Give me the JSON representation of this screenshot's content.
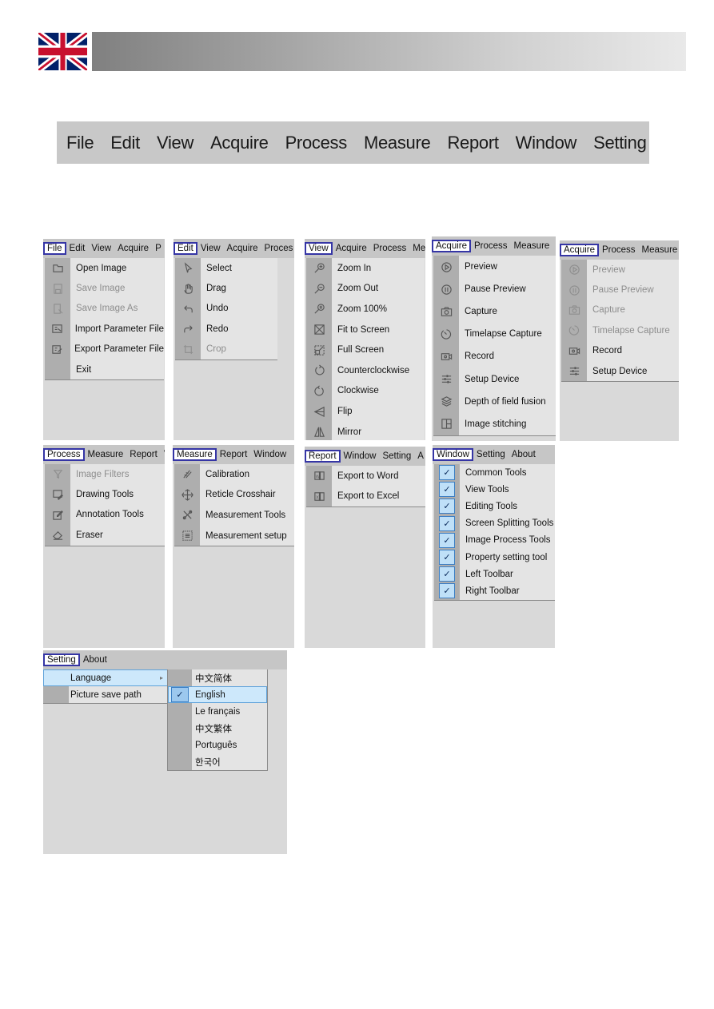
{
  "header": {
    "flag_icon": "uk-flag-icon"
  },
  "main_menu": [
    "File",
    "Edit",
    "View",
    "Acquire",
    "Process",
    "Measure",
    "Report",
    "Window",
    "Setting"
  ],
  "panels": {
    "file": {
      "bar": [
        "File",
        "Edit",
        "View",
        "Acquire",
        "P"
      ],
      "items": [
        {
          "label": "Open Image",
          "icon": "folder-icon",
          "enabled": true
        },
        {
          "label": "Save Image",
          "icon": "save-icon",
          "enabled": false
        },
        {
          "label": "Save Image As",
          "icon": "save-as-icon",
          "enabled": false
        },
        {
          "label": "Import Parameter File",
          "icon": "import-icon",
          "enabled": true
        },
        {
          "label": "Export Parameter File",
          "icon": "export-icon",
          "enabled": true
        },
        {
          "label": "Exit",
          "icon": "",
          "enabled": true
        }
      ]
    },
    "edit": {
      "bar": [
        "Edit",
        "View",
        "Acquire",
        "Proces"
      ],
      "items": [
        {
          "label": "Select",
          "icon": "cursor-icon",
          "enabled": true
        },
        {
          "label": "Drag",
          "icon": "hand-icon",
          "enabled": true
        },
        {
          "label": "Undo",
          "icon": "undo-icon",
          "enabled": true
        },
        {
          "label": "Redo",
          "icon": "redo-icon",
          "enabled": true
        },
        {
          "label": "Crop",
          "icon": "crop-icon",
          "enabled": false
        }
      ]
    },
    "view": {
      "bar": [
        "View",
        "Acquire",
        "Process",
        "Me"
      ],
      "items": [
        {
          "label": "Zoom In",
          "icon": "zoom-in-icon",
          "enabled": true
        },
        {
          "label": "Zoom Out",
          "icon": "zoom-out-icon",
          "enabled": true
        },
        {
          "label": "Zoom 100%",
          "icon": "zoom-100-icon",
          "enabled": true
        },
        {
          "label": "Fit to Screen",
          "icon": "fit-screen-icon",
          "enabled": true
        },
        {
          "label": "Full Screen",
          "icon": "full-screen-icon",
          "enabled": true
        },
        {
          "label": "Counterclockwise",
          "icon": "rotate-ccw-icon",
          "enabled": true
        },
        {
          "label": "Clockwise",
          "icon": "rotate-cw-icon",
          "enabled": true
        },
        {
          "label": "Flip",
          "icon": "flip-icon",
          "enabled": true
        },
        {
          "label": "Mirror",
          "icon": "mirror-icon",
          "enabled": true
        }
      ]
    },
    "acquire1": {
      "bar": [
        "Acquire",
        "Process",
        "Measure"
      ],
      "items": [
        {
          "label": "Preview",
          "icon": "play-icon",
          "enabled": true
        },
        {
          "label": "Pause Preview",
          "icon": "pause-icon",
          "enabled": true
        },
        {
          "label": "Capture",
          "icon": "camera-icon",
          "enabled": true
        },
        {
          "label": "Timelapse Capture",
          "icon": "timer-icon",
          "enabled": true
        },
        {
          "label": "Record",
          "icon": "video-icon",
          "enabled": true
        },
        {
          "label": "Setup Device",
          "icon": "sliders-icon",
          "enabled": true
        },
        {
          "label": "Depth of field fusion",
          "icon": "layers-icon",
          "enabled": true
        },
        {
          "label": "Image stitching",
          "icon": "stitch-icon",
          "enabled": true
        }
      ]
    },
    "acquire2": {
      "bar": [
        "Acquire",
        "Process",
        "Measure"
      ],
      "items": [
        {
          "label": "Preview",
          "icon": "play-icon",
          "enabled": false
        },
        {
          "label": "Pause Preview",
          "icon": "pause-icon",
          "enabled": false
        },
        {
          "label": "Capture",
          "icon": "camera-icon",
          "enabled": false
        },
        {
          "label": "Timelapse Capture",
          "icon": "timer-icon",
          "enabled": false
        },
        {
          "label": "Record",
          "icon": "video-icon",
          "enabled": true
        },
        {
          "label": "Setup Device",
          "icon": "sliders-icon",
          "enabled": true
        }
      ]
    },
    "process": {
      "bar": [
        "Process",
        "Measure",
        "Report",
        "V"
      ],
      "items": [
        {
          "label": "Image Filters",
          "icon": "filter-icon",
          "enabled": false
        },
        {
          "label": "Drawing Tools",
          "icon": "drawing-icon",
          "enabled": true
        },
        {
          "label": "Annotation Tools",
          "icon": "annotation-icon",
          "enabled": true
        },
        {
          "label": "Eraser",
          "icon": "eraser-icon",
          "enabled": true
        }
      ]
    },
    "measure": {
      "bar": [
        "Measure",
        "Report",
        "Window"
      ],
      "items": [
        {
          "label": "Calibration",
          "icon": "calibration-icon",
          "enabled": true
        },
        {
          "label": "Reticle Crosshair",
          "icon": "crosshair-icon",
          "enabled": true
        },
        {
          "label": "Measurement Tools",
          "icon": "measure-tools-icon",
          "enabled": true
        },
        {
          "label": "Measurement setup",
          "icon": "measure-setup-icon",
          "enabled": true
        }
      ]
    },
    "report": {
      "bar": [
        "Report",
        "Window",
        "Setting",
        "A"
      ],
      "items": [
        {
          "label": "Export to Word",
          "icon": "word-icon",
          "enabled": true
        },
        {
          "label": "Export to Excel",
          "icon": "excel-icon",
          "enabled": true
        }
      ]
    },
    "window": {
      "bar": [
        "Window",
        "Setting",
        "About"
      ],
      "items": [
        {
          "label": "Common Tools",
          "checked": true
        },
        {
          "label": "View Tools",
          "checked": true
        },
        {
          "label": "Editing Tools",
          "checked": true
        },
        {
          "label": "Screen Splitting Tools",
          "checked": true
        },
        {
          "label": "Image Process Tools",
          "checked": true
        },
        {
          "label": "Property setting tool",
          "checked": true
        },
        {
          "label": "Left Toolbar",
          "checked": true
        },
        {
          "label": "Right Toolbar",
          "checked": true
        }
      ],
      "check_glyph": "✓"
    },
    "setting": {
      "bar": [
        "Setting",
        "About"
      ],
      "items": [
        {
          "label": "Language",
          "has_submenu": true
        },
        {
          "label": "Picture save path",
          "has_submenu": false
        }
      ],
      "submenu_arrow": "▸",
      "languages": [
        {
          "label": "中文简体",
          "selected": false
        },
        {
          "label": "English",
          "selected": true
        },
        {
          "label": "Le français",
          "selected": false
        },
        {
          "label": "中文繁体",
          "selected": false
        },
        {
          "label": "Português",
          "selected": false
        },
        {
          "label": "한국어",
          "selected": false
        }
      ],
      "check_glyph": "✓"
    }
  }
}
